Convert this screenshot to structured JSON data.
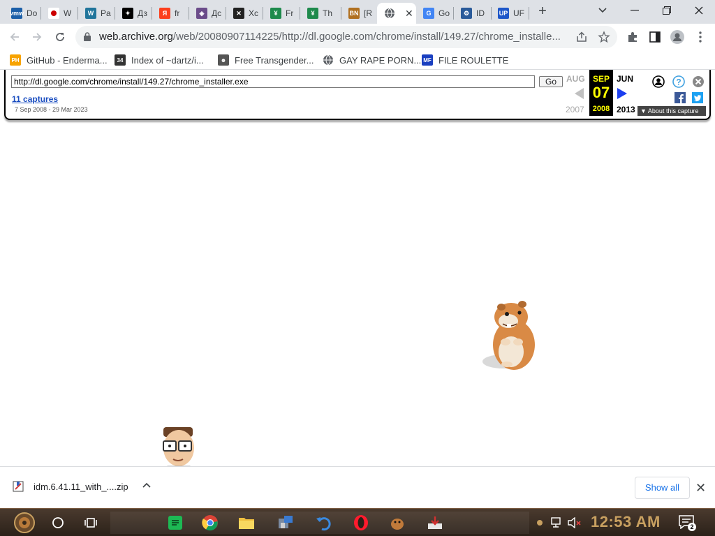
{
  "tabs": [
    {
      "label": "Do",
      "icon": "vmware-icon",
      "color": "#1b5fa8",
      "glyph": "vmw"
    },
    {
      "label": "W",
      "icon": "japan-flag-icon",
      "color": "#ffffff",
      "glyph": ""
    },
    {
      "label": "Pa",
      "icon": "wordpress-icon",
      "color": "#21759b",
      "glyph": "W"
    },
    {
      "label": "Дз",
      "icon": "dzen-icon",
      "color": "#000000",
      "glyph": "✦"
    },
    {
      "label": "fr",
      "icon": "yandex-icon",
      "color": "#fc3f1d",
      "glyph": "Я"
    },
    {
      "label": "Дс",
      "icon": "badge-icon",
      "color": "#6b4c8a",
      "glyph": "◈"
    },
    {
      "label": "Xc",
      "icon": "x-cross-icon",
      "color": "#222222",
      "glyph": "✕"
    },
    {
      "label": "Fr",
      "icon": "yt-green-icon",
      "color": "#1e8a4c",
      "glyph": "¥"
    },
    {
      "label": "Th",
      "icon": "yt-green-icon",
      "color": "#1e8a4c",
      "glyph": "¥"
    },
    {
      "label": "[R",
      "icon": "bn-icon",
      "color": "#b07020",
      "glyph": "BN"
    },
    {
      "label": "",
      "icon": "globe-icon",
      "color": "#5f6368",
      "glyph": "",
      "active": true
    },
    {
      "label": "Go",
      "icon": "google-icon",
      "color": "#4285f4",
      "glyph": "G"
    },
    {
      "label": "ID",
      "icon": "idm-icon",
      "color": "#2b5b9a",
      "glyph": "⚙"
    },
    {
      "label": "UF",
      "icon": "uf-icon",
      "color": "#1e57c9",
      "glyph": "UP"
    }
  ],
  "address_bar": {
    "host": "web.archive.org",
    "path": "/web/20080907114225/http://dl.google.com/chrome/install/149.27/chrome_installe..."
  },
  "bookmarks": [
    {
      "label": "GitHub - Enderma...",
      "icon": "ph-icon",
      "color": "#f7a300",
      "glyph": "PH"
    },
    {
      "label": "Index of ~dartz/i...",
      "icon": "dartz-icon",
      "color": "#333333",
      "glyph": "34"
    },
    {
      "label": "Free Transgender...",
      "icon": "mascot-icon",
      "color": "#555555",
      "glyph": "☻"
    },
    {
      "label": "GAY RAPE PORN...",
      "icon": "globe-icon",
      "color": "#5f6368",
      "glyph": ""
    },
    {
      "label": "FILE ROULETTE",
      "icon": "mf-icon",
      "color": "#1a3fc0",
      "glyph": "MF"
    }
  ],
  "wayback": {
    "url_value": "http://dl.google.com/chrome/install/149.27/chrome_installer.exe",
    "go_label": "Go",
    "captures_label": "11 captures",
    "range_label": "7 Sep 2008 - 29 Mar 2023",
    "prev_month": "AUG",
    "prev_year": "2007",
    "cur_month": "SEP",
    "cur_day": "07",
    "cur_year": "2008",
    "next_month": "JUN",
    "next_year": "2013",
    "about_label": "About this capture"
  },
  "downloads": {
    "file_name": "idm.6.41.11_with_....zip",
    "show_all_label": "Show all"
  },
  "taskbar": {
    "clock": "12:53 AM",
    "notification_count": "2"
  }
}
